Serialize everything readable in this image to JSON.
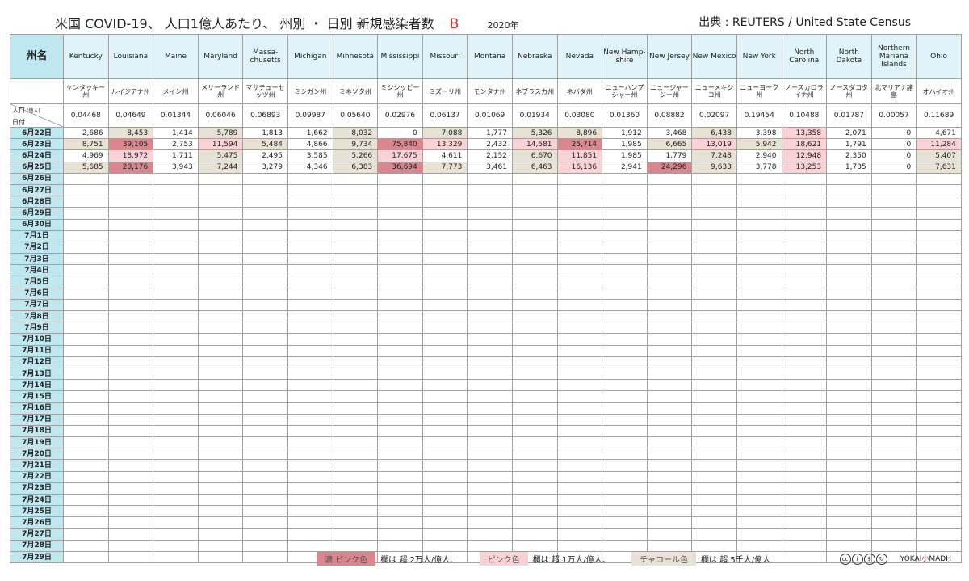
{
  "title": "米国 COVID-19、 人口1億人あたり、 州別 ・ 日別 新規感染者数",
  "title_letter": "B",
  "year": "2020年",
  "source": "出典 : REUTERS / United State Census",
  "corner_label": "州名",
  "pop_label": "人口",
  "pop_unit": "(億人)",
  "date_label": "日付",
  "colors": {
    "header_bg": "#dff3f8",
    "date_bg": "#bfe7f0",
    "charcoal": "#e8e2d4",
    "pink": "#fad2d6",
    "dark_pink": "#d9868e"
  },
  "states": [
    {
      "en": "Kentucky",
      "jp": "ケンタッキー州",
      "pop": "0.04468"
    },
    {
      "en": "Louisiana",
      "jp": "ルイジアナ州",
      "pop": "0.04649"
    },
    {
      "en": "Maine",
      "jp": "メイン州",
      "pop": "0.01344"
    },
    {
      "en": "Maryland",
      "jp": "メリーランド州",
      "pop": "0.06046"
    },
    {
      "en": "Massa-chusetts",
      "jp": "マサチューセッツ州",
      "pop": "0.06893"
    },
    {
      "en": "Michigan",
      "jp": "ミシガン州",
      "pop": "0.09987"
    },
    {
      "en": "Minnesota",
      "jp": "ミネソタ州",
      "pop": "0.05640"
    },
    {
      "en": "Mississippi",
      "jp": "ミシシッピー州",
      "pop": "0.02976"
    },
    {
      "en": "Missouri",
      "jp": "ミズーリ州",
      "pop": "0.06137"
    },
    {
      "en": "Montana",
      "jp": "モンタナ州",
      "pop": "0.01069"
    },
    {
      "en": "Nebraska",
      "jp": "ネブラスカ州",
      "pop": "0.01934"
    },
    {
      "en": "Nevada",
      "jp": "ネバダ州",
      "pop": "0.03080"
    },
    {
      "en": "New Hamp-shire",
      "jp": "ニューハンプシャー州",
      "pop": "0.01360"
    },
    {
      "en": "New Jersey",
      "jp": "ニュージャージー州",
      "pop": "0.08882"
    },
    {
      "en": "New Mexico",
      "jp": "ニューメキシコ州",
      "pop": "0.02097"
    },
    {
      "en": "New York",
      "jp": "ニューヨーク州",
      "pop": "0.19454"
    },
    {
      "en": "North Carolina",
      "jp": "ノースカロライナ州",
      "pop": "0.10488"
    },
    {
      "en": "North Dakota",
      "jp": "ノースダコタ州",
      "pop": "0.01787"
    },
    {
      "en": "Northern Mariana Islands",
      "jp": "北マリアナ諸島",
      "pop": "0.00057"
    },
    {
      "en": "Ohio",
      "jp": "オハイオ州",
      "pop": "0.11689"
    }
  ],
  "dates": [
    "6月22日",
    "6月23日",
    "6月24日",
    "6月25日",
    "6月26日",
    "6月27日",
    "6月28日",
    "6月29日",
    "6月30日",
    "7月1日",
    "7月2日",
    "7月3日",
    "7月4日",
    "7月5日",
    "7月6日",
    "7月7日",
    "7月8日",
    "7月9日",
    "7月10日",
    "7月11日",
    "7月12日",
    "7月13日",
    "7月14日",
    "7月15日",
    "7月16日",
    "7月17日",
    "7月18日",
    "7月19日",
    "7月20日",
    "7月21日",
    "7月22日",
    "7月23日",
    "7月24日",
    "7月25日",
    "7月26日",
    "7月27日",
    "7月28日",
    "7月29日"
  ],
  "rows": [
    [
      "2,686",
      "8,453",
      "1,414",
      "5,789",
      "1,813",
      "1,662",
      "8,032",
      "0",
      "7,088",
      "1,777",
      "5,326",
      "8,896",
      "1,912",
      "3,468",
      "6,438",
      "3,398",
      "13,358",
      "2,071",
      "0",
      "4,671"
    ],
    [
      "8,751",
      "39,105",
      "2,753",
      "11,594",
      "5,484",
      "4,866",
      "9,734",
      "75,840",
      "13,329",
      "2,432",
      "14,581",
      "25,714",
      "1,985",
      "6,665",
      "13,019",
      "5,942",
      "18,621",
      "1,791",
      "0",
      "11,284"
    ],
    [
      "4,969",
      "18,972",
      "1,711",
      "5,475",
      "2,495",
      "3,585",
      "5,266",
      "17,675",
      "4,611",
      "2,152",
      "6,670",
      "11,851",
      "1,985",
      "1,779",
      "7,248",
      "2,940",
      "12,948",
      "2,350",
      "0",
      "5,407"
    ],
    [
      "5,685",
      "20,176",
      "3,943",
      "7,244",
      "3,279",
      "4,346",
      "6,383",
      "36,694",
      "7,773",
      "3,461",
      "6,463",
      "16,136",
      "2,941",
      "24,296",
      "9,633",
      "3,778",
      "13,253",
      "1,735",
      "0",
      "7,631"
    ]
  ],
  "legend": {
    "dark_pink_label": "濃 ピンク色",
    "dark_pink_text": "欄は 超 2万人/億人、",
    "pink_label": "ピンク色",
    "pink_text": "欄は 超 1万人/億人、",
    "charcoal_label": "チャコール色",
    "charcoal_text": "欄は 超 5千人/億人"
  },
  "logo": {
    "cc_icons": [
      "cc-icon",
      "by-icon",
      "nc-icon",
      "sa-icon"
    ],
    "brand_a": "YOKAI",
    "brand_b": "小",
    "brand_c": "MADH"
  }
}
